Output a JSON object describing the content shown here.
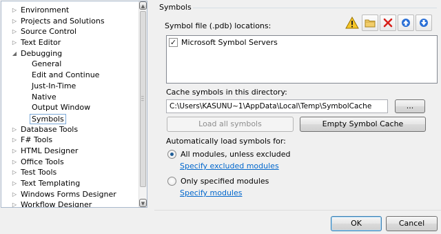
{
  "tree": {
    "items": [
      {
        "label": "Environment",
        "level": 0,
        "expanded": false
      },
      {
        "label": "Projects and Solutions",
        "level": 0,
        "expanded": false
      },
      {
        "label": "Source Control",
        "level": 0,
        "expanded": false
      },
      {
        "label": "Text Editor",
        "level": 0,
        "expanded": false
      },
      {
        "label": "Debugging",
        "level": 0,
        "expanded": true
      },
      {
        "label": "General",
        "level": 1
      },
      {
        "label": "Edit and Continue",
        "level": 1
      },
      {
        "label": "Just-In-Time",
        "level": 1
      },
      {
        "label": "Native",
        "level": 1
      },
      {
        "label": "Output Window",
        "level": 1
      },
      {
        "label": "Symbols",
        "level": 1,
        "selected": true
      },
      {
        "label": "Database Tools",
        "level": 0,
        "expanded": false
      },
      {
        "label": "F# Tools",
        "level": 0,
        "expanded": false
      },
      {
        "label": "HTML Designer",
        "level": 0,
        "expanded": false
      },
      {
        "label": "Office Tools",
        "level": 0,
        "expanded": false
      },
      {
        "label": "Test Tools",
        "level": 0,
        "expanded": false
      },
      {
        "label": "Text Templating",
        "level": 0,
        "expanded": false
      },
      {
        "label": "Windows Forms Designer",
        "level": 0,
        "expanded": false
      },
      {
        "label": "Workflow Designer",
        "level": 0,
        "expanded": false
      }
    ]
  },
  "symbols": {
    "group_title": "Symbols",
    "locations_label": "Symbol file (.pdb) locations:",
    "toolbar": [
      "warning-icon",
      "folder-icon",
      "delete-icon",
      "move-up-icon",
      "move-down-icon"
    ],
    "locations": [
      {
        "label": "Microsoft Symbol Servers",
        "checked": true
      }
    ],
    "cache_label": "Cache symbols in this directory:",
    "cache_path": "C:\\Users\\KASUNU~1\\AppData\\Local\\Temp\\SymbolCache",
    "browse_label": "...",
    "load_all_label": "Load all symbols",
    "empty_cache_label": "Empty Symbol Cache",
    "auto_load_label": "Automatically load symbols for:",
    "option_all": "All modules, unless excluded",
    "link_excluded": "Specify excluded modules",
    "option_specified": "Only specified modules",
    "link_modules": "Specify modules",
    "selected_option": "all"
  },
  "dialog": {
    "ok_label": "OK",
    "cancel_label": "Cancel"
  }
}
